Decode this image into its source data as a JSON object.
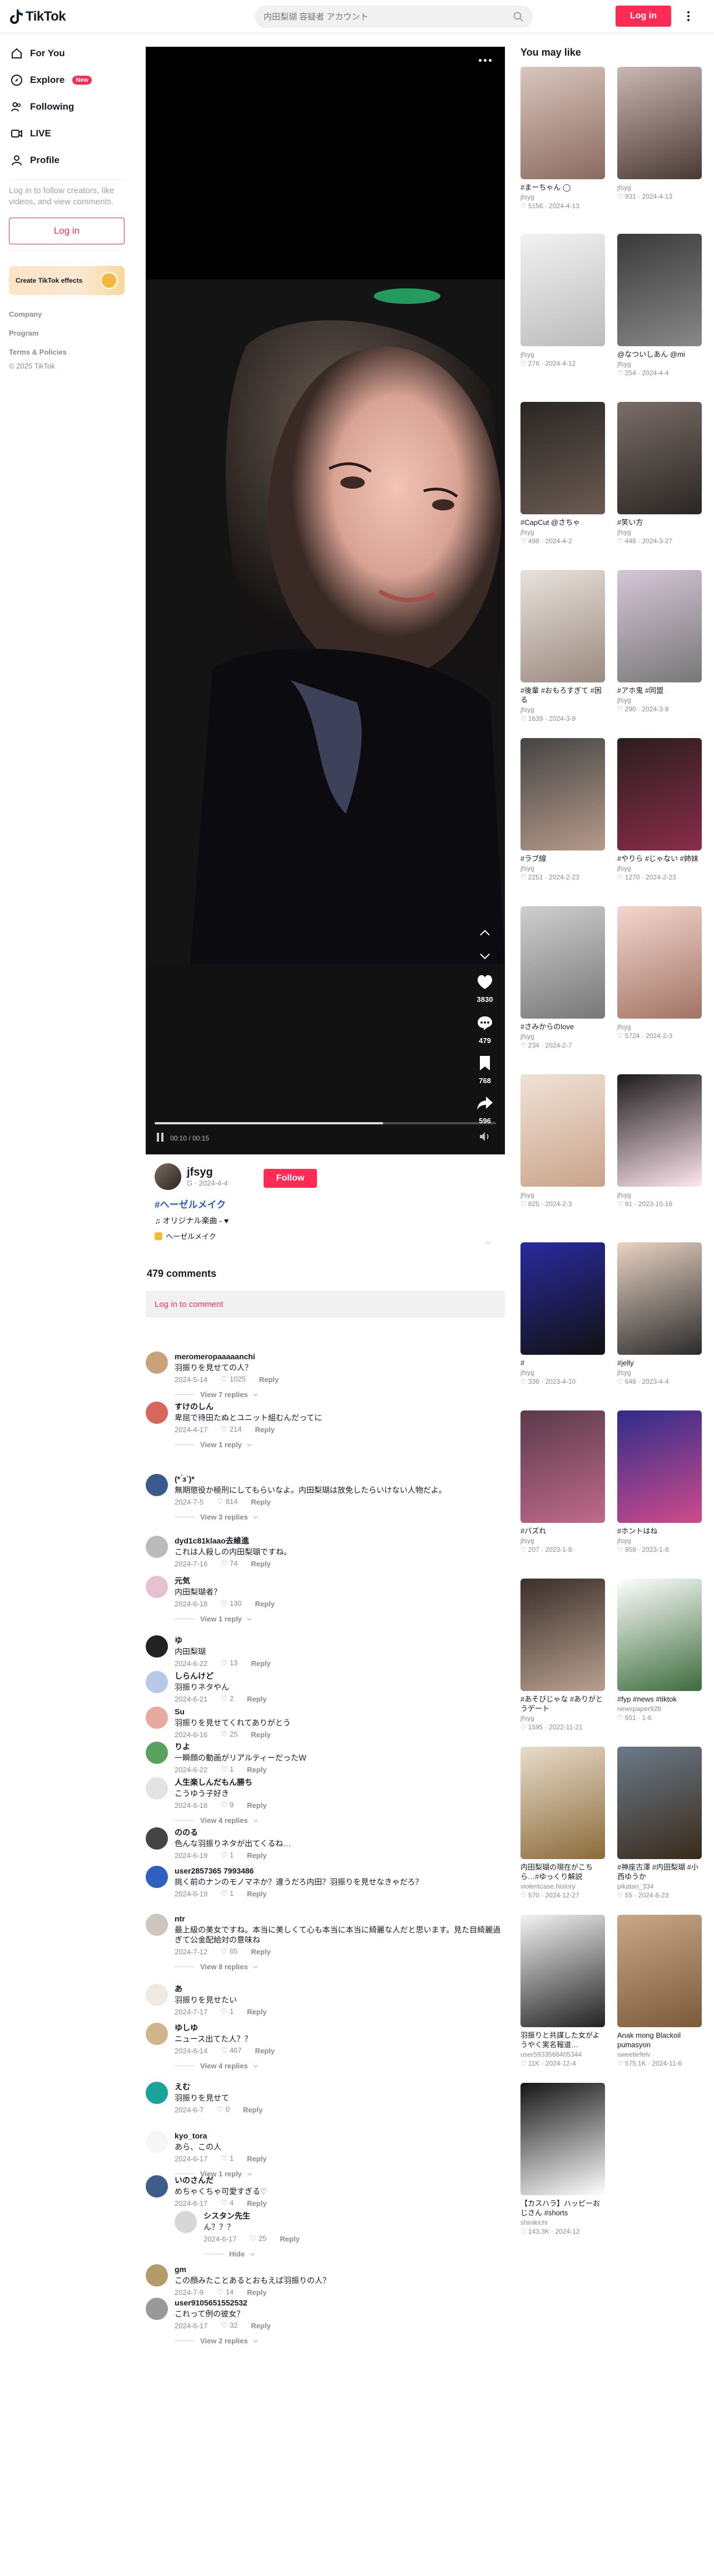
{
  "header": {
    "brand": "TikTok",
    "search_placeholder": "内田梨瑚 容疑者 アカウント",
    "login_label": "Log in"
  },
  "nav": {
    "items": [
      {
        "label": "For You",
        "icon": "home-icon"
      },
      {
        "label": "Explore",
        "icon": "compass-icon",
        "badge": "New"
      },
      {
        "label": "Following",
        "icon": "users-icon"
      },
      {
        "label": "LIVE",
        "icon": "live-icon"
      },
      {
        "label": "Profile",
        "icon": "person-icon"
      }
    ],
    "hint": "Log in to follow creators, like videos, and view comments.",
    "login_label": "Log in",
    "effects_label": "Create TikTok effects",
    "footer": [
      "Company",
      "Program",
      "Terms & Policies"
    ],
    "copyright": "© 2025 TikTok"
  },
  "video": {
    "time": "00:10 / 00:15",
    "progress": 0.67,
    "likes": "3830",
    "comments": "479",
    "saves": "768",
    "shares": "596"
  },
  "author": {
    "name": "jfsyg",
    "sub": "G · 2024-4-4",
    "follow_label": "Follow",
    "title": "#ヘーゼルメイク",
    "music": "♫ オリジナル楽曲 - ♥",
    "tag": "ヘーゼルメイク"
  },
  "comments": {
    "count_label": "479 comments",
    "login_label": "Log in to comment",
    "list": [
      {
        "user": "meromeropaaaaanchi",
        "text": "羽振りを見せての人？",
        "date": "2024-5-14",
        "likes": "1025",
        "replies": "View 7 replies"
      },
      {
        "user": "すけのしん",
        "text": "卑屈で待田たぬとユニット組むんだってに",
        "date": "2024-4-17",
        "likes": "214",
        "replies": "View 1 reply"
      },
      {
        "user": "(* ́з`)*",
        "text": "無期懲役か極刑にしてもらいなよ。内田梨瑚は放免したらいけない人物だよ。",
        "date": "2024-7-5",
        "likes": "814",
        "replies": "View 3 replies"
      },
      {
        "user": "dyd1c81klaao去維進",
        "text": "これは人殺しの内田梨瑚ですね。",
        "date": "2024-7-16",
        "likes": "74",
        "replies": ""
      },
      {
        "user": "元気",
        "text": "内田梨瑚者？",
        "date": "2024-6-18",
        "likes": "130",
        "replies": "View 1 reply"
      },
      {
        "user": "ゆ",
        "text": "内田梨瑚",
        "date": "2024-6-22",
        "likes": "13",
        "replies": ""
      },
      {
        "user": "しらんけど",
        "text": "羽振りネタやん",
        "date": "2024-6-21",
        "likes": "2",
        "replies": ""
      },
      {
        "user": "Su",
        "text": "羽振りを見せてくれてありがとう",
        "date": "2024-6-16",
        "likes": "25",
        "replies": ""
      },
      {
        "user": "りよ",
        "text": "一瞬顔の動画がリアルティーだったＷ",
        "date": "2024-6-22",
        "likes": "1",
        "replies": ""
      },
      {
        "user": "人生楽しんだもん勝ち",
        "text": "こうゆう子好き",
        "date": "2024-6-16",
        "likes": "9",
        "replies": "View 4 replies"
      },
      {
        "user": "ののる",
        "text": "色んな羽振りネタが出てくるね…",
        "date": "2024-6-19",
        "likes": "1",
        "replies": ""
      },
      {
        "user": "user2857365 7993486",
        "text": "挑く前のナンのモノマネか？違うだろ内田？羽振りを見せなきゃだろ？",
        "date": "2024-6-19",
        "likes": "1",
        "replies": ""
      },
      {
        "user": "ntr",
        "text": "最上級の美女ですね。本当に美しくて心も本当に本当に綺麗な人だと思います。見た目綺麗過ぎて公金配給対の意味ね",
        "date": "2024-7-12",
        "likes": "65",
        "replies": "View 8 replies"
      },
      {
        "user": "あ",
        "text": "羽振りを見せたい",
        "date": "2024-7-17",
        "likes": "1",
        "replies": ""
      },
      {
        "user": "ゆしゆ",
        "text": "ニュース出てた人？？",
        "date": "2024-6-14",
        "likes": "467",
        "replies": "View 4 replies"
      },
      {
        "user": "えむ",
        "text": "羽振りを見せて",
        "date": "2024-6-7",
        "likes": "0",
        "replies": ""
      },
      {
        "user": "kyo_tora",
        "text": "あら、この人",
        "date": "2024-6-17",
        "likes": "1",
        "replies": "View 1 reply"
      },
      {
        "user": "いのさんだ",
        "text": "めちゃくちゃ可愛すぎる♡",
        "date": "2024-6-17",
        "likes": "4",
        "replies": ""
      },
      {
        "user": "シスタン先生",
        "text": "ん？？？",
        "date": "2024-6-17",
        "likes": "25",
        "replies": "Hide"
      },
      {
        "user": "gm",
        "text": "この顔みたことあるとおもえば羽振りの人？",
        "date": "2024-7-9",
        "likes": "14",
        "replies": ""
      },
      {
        "user": "user9105651552532",
        "text": "これって例の彼女？",
        "date": "2024-6-17",
        "likes": "32",
        "replies": "View 2 replies"
      }
    ]
  },
  "right": {
    "heading": "You may like",
    "cards": [
      {
        "title": "#まーちゃん ◯",
        "author": "jfsyg",
        "likes": "5156",
        "date": "2024-4-13"
      },
      {
        "title": "",
        "author": "jfsyg",
        "likes": "931",
        "date": "2024-4-13"
      },
      {
        "title": "",
        "author": "jfsyg",
        "likes": "276",
        "date": "2024-4-12"
      },
      {
        "title": "@なついしあん @mi",
        "author": "jfsyg",
        "likes": "254",
        "date": "2024-4-4"
      },
      {
        "title": "#CapCut @さちゃ",
        "author": "jfsyg",
        "likes": "498",
        "date": "2024-4-2"
      },
      {
        "title": "#笑い方",
        "author": "jfsyg",
        "likes": "448",
        "date": "2024-3-27"
      },
      {
        "title": "#後輩 #おもろすぎて #困る",
        "author": "jfsyg",
        "likes": "1639",
        "date": "2024-3-9"
      },
      {
        "title": "#アホ鬼 #同盟",
        "author": "jfsyg",
        "likes": "290",
        "date": "2024-3-9"
      },
      {
        "title": "#ラブ線",
        "author": "jfsyg",
        "likes": "2251",
        "date": "2024-2-23"
      },
      {
        "title": "#やりら #じゃない #姉妹",
        "author": "jfsyg",
        "likes": "1270",
        "date": "2024-2-23"
      },
      {
        "title": "#さみからのlove",
        "author": "jfsyg",
        "likes": "234",
        "date": "2024-2-7"
      },
      {
        "title": "",
        "author": "jfsyg",
        "likes": "5724",
        "date": "2024-2-3"
      },
      {
        "title": "",
        "author": "jfsyg",
        "likes": "825",
        "date": "2024-2-3"
      },
      {
        "title": "",
        "author": "jfsyg",
        "likes": "91",
        "date": "2023-10-16"
      },
      {
        "title": "#",
        "author": "jfsyg",
        "likes": "336",
        "date": "2023-4-10"
      },
      {
        "title": "#jelly",
        "author": "jfsyg",
        "likes": "648",
        "date": "2023-4-4"
      },
      {
        "title": "#バズれ",
        "author": "jfsyg",
        "likes": "207",
        "date": "2023-1-8"
      },
      {
        "title": "#ホントはね",
        "author": "jfsyg",
        "likes": "959",
        "date": "2023-1-8"
      },
      {
        "title": "#あそびじゃな #ありがとうデート",
        "author": "jfsyg",
        "likes": "1595",
        "date": "2022-11-21"
      },
      {
        "title": "#fyp #news #tiktok",
        "author": "newspaper928",
        "likes": "651",
        "date": "1-6"
      },
      {
        "title": "内田梨瑚の現在がこちら…#ゆっくり解説",
        "author": "violentcase.history",
        "likes": "570",
        "date": "2024-12-27"
      },
      {
        "title": "#神座古澤 #内田梨瑚 #小西ゆうか",
        "author": "pikatan_334",
        "likes": "55",
        "date": "2024-8-23"
      },
      {
        "title": "羽振りと共謀した女がようやく実名報道…",
        "author": "user5933566405344",
        "likes": "11K",
        "date": "2024-12-4"
      },
      {
        "title": "Anak mong Blackoil pumasyon",
        "author": "sweetiefelv",
        "likes": "575.1K",
        "date": "2024-11-6"
      },
      {
        "title": "【カスハラ】ハッピーおじさん #shorts",
        "author": "shinikichi",
        "likes": "143.3K",
        "date": "2024-12"
      }
    ]
  }
}
